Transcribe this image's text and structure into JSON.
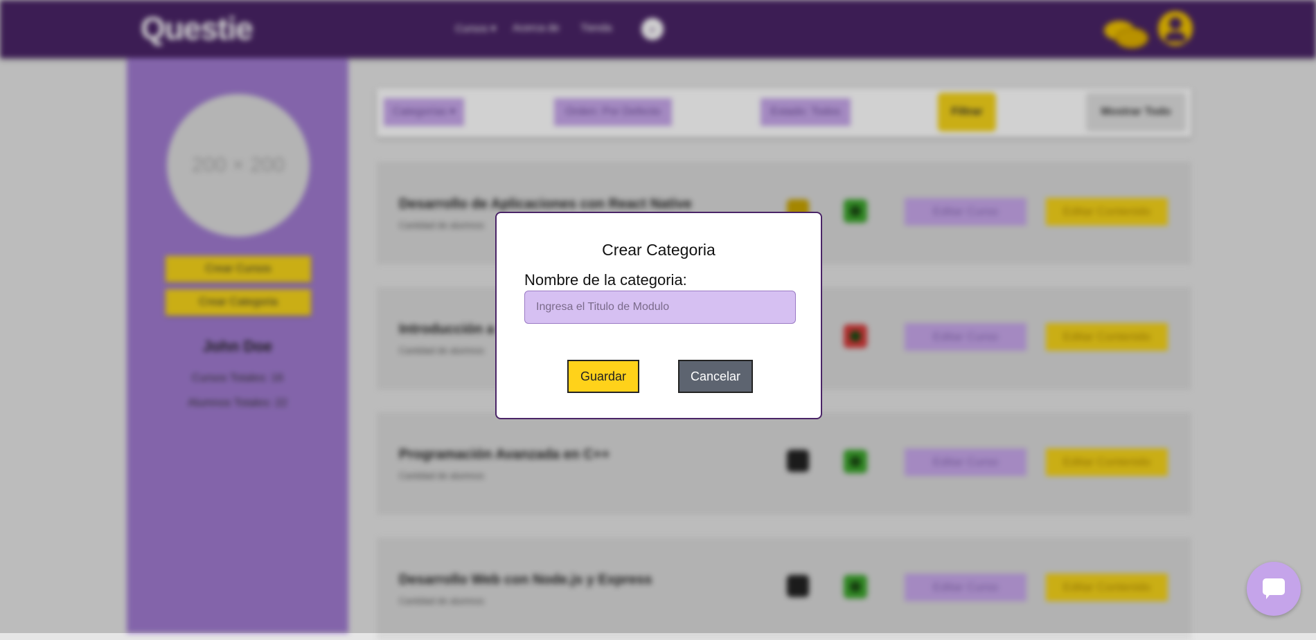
{
  "header": {
    "logo": "Questie",
    "nav": [
      "Cursos ▾",
      "Acerca de",
      "Tienda"
    ]
  },
  "sidebar": {
    "avatar_placeholder": "200 × 200",
    "buttons": [
      "Crear Cursos",
      "Crear Categoria"
    ],
    "name": "John Doe",
    "stats": [
      "Cursos Totales: 16",
      "Alumnos Totales: 22"
    ]
  },
  "filters": {
    "categorias": "Categorías ▾",
    "orden": "Orden: Por Defecto",
    "estado": "Estado: Todos",
    "filtrar": "Filtrar",
    "mostrar": "Mostrar Todo"
  },
  "courses": [
    {
      "title": "Desarrollo de Aplicaciones con React Native",
      "subtitle": "Cantidad de alumnos",
      "edit": "Editar Curso",
      "content": "Editar Contenido"
    },
    {
      "title": "Introducción a",
      "subtitle": "Cantidad de alumnos",
      "edit": "Editar Curso",
      "content": "Editar Contenido"
    },
    {
      "title": "Programación Avanzada en C++",
      "subtitle": "Cantidad de alumnos",
      "edit": "Editar Curso",
      "content": "Editar Contenido"
    },
    {
      "title": "Desarrollo Web con Node.js y Express",
      "subtitle": "Cantidad de alumnos",
      "edit": "Editar Curso",
      "content": "Editar Contenido"
    }
  ],
  "modal": {
    "title": "Crear Categoria",
    "label": "Nombre de la categoria:",
    "input_placeholder": "Ingresa el Titulo de Modulo",
    "input_value": "",
    "save": "Guardar",
    "cancel": "Cancelar"
  },
  "colors": {
    "brand": "#4a2467",
    "accent_yellow": "#ffd21a",
    "lilac": "#c8a8ec"
  }
}
